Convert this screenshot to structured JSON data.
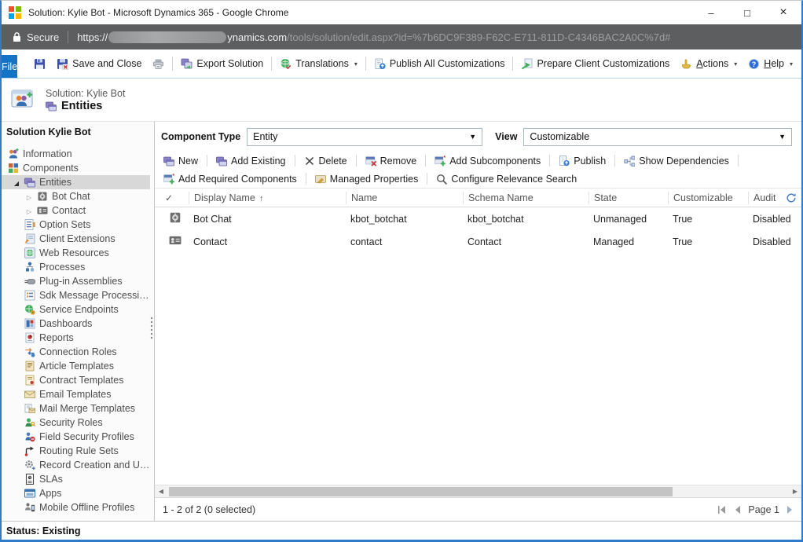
{
  "window": {
    "title": "Solution: Kylie Bot - Microsoft Dynamics 365 - Google Chrome",
    "minimize": "–",
    "maximize": "□",
    "close": "×"
  },
  "address": {
    "secure": "Secure",
    "scheme": "https://",
    "domain": "ynamics.com",
    "path": "/tools/solution/edit.aspx?id=%7b6DC9F389-F62C-E711-811D-C4346BAC2A0C%7d#"
  },
  "ribbon": {
    "file": "File",
    "save_and_close": "Save and Close",
    "export_solution": "Export Solution",
    "translations": "Translations",
    "publish_all": "Publish All Customizations",
    "prepare_client": "Prepare Client Customizations",
    "actions": "Actions",
    "help": "Help"
  },
  "header": {
    "solution": "Solution: Kylie Bot",
    "title": "Entities"
  },
  "sidebar": {
    "title": "Solution Kylie Bot",
    "items": [
      {
        "label": "Information",
        "icon": "information-icon"
      },
      {
        "label": "Components",
        "icon": "components-icon"
      },
      {
        "label": "Entities",
        "icon": "entities-icon",
        "selected": true,
        "expanded": true
      },
      {
        "label": "Bot Chat",
        "icon": "bot-chat-entity-icon",
        "expanded": false
      },
      {
        "label": "Contact",
        "icon": "contact-entity-icon",
        "expanded": false
      },
      {
        "label": "Option Sets",
        "icon": "option-sets-icon"
      },
      {
        "label": "Client Extensions",
        "icon": "client-extensions-icon"
      },
      {
        "label": "Web Resources",
        "icon": "web-resources-icon"
      },
      {
        "label": "Processes",
        "icon": "processes-icon"
      },
      {
        "label": "Plug-in Assemblies",
        "icon": "plugin-assemblies-icon"
      },
      {
        "label": "Sdk Message Processing St...",
        "icon": "sdk-message-steps-icon"
      },
      {
        "label": "Service Endpoints",
        "icon": "service-endpoints-icon"
      },
      {
        "label": "Dashboards",
        "icon": "dashboards-icon"
      },
      {
        "label": "Reports",
        "icon": "reports-icon"
      },
      {
        "label": "Connection Roles",
        "icon": "connection-roles-icon"
      },
      {
        "label": "Article Templates",
        "icon": "article-templates-icon"
      },
      {
        "label": "Contract Templates",
        "icon": "contract-templates-icon"
      },
      {
        "label": "Email Templates",
        "icon": "email-templates-icon"
      },
      {
        "label": "Mail Merge Templates",
        "icon": "mail-merge-templates-icon"
      },
      {
        "label": "Security Roles",
        "icon": "security-roles-icon"
      },
      {
        "label": "Field Security Profiles",
        "icon": "field-security-profiles-icon"
      },
      {
        "label": "Routing Rule Sets",
        "icon": "routing-rule-sets-icon"
      },
      {
        "label": "Record Creation and Upda...",
        "icon": "record-creation-icon"
      },
      {
        "label": "SLAs",
        "icon": "slas-icon"
      },
      {
        "label": "Apps",
        "icon": "apps-icon"
      },
      {
        "label": "Mobile Offline Profiles",
        "icon": "mobile-offline-profiles-icon"
      }
    ]
  },
  "main": {
    "component_type_label": "Component Type",
    "component_type_value": "Entity",
    "view_label": "View",
    "view_value": "Customizable",
    "toolbar": {
      "new": "New",
      "add_existing": "Add Existing",
      "delete": "Delete",
      "remove": "Remove",
      "add_subcomponents": "Add Subcomponents",
      "publish": "Publish",
      "show_dependencies": "Show Dependencies",
      "add_required": "Add Required Components",
      "managed_properties": "Managed Properties",
      "configure_relevance": "Configure Relevance Search"
    },
    "table": {
      "columns": [
        "Display Name",
        "Name",
        "Schema Name",
        "State",
        "Customizable",
        "Audit"
      ],
      "sort": {
        "column": "Display Name",
        "direction": "ascending"
      },
      "rows": [
        {
          "display_name": "Bot Chat",
          "name": "kbot_botchat",
          "schema_name": "kbot_botchat",
          "state": "Unmanaged",
          "customizable": "True",
          "audit": "Disabled",
          "icon": "bot-chat-entity-icon"
        },
        {
          "display_name": "Contact",
          "name": "contact",
          "schema_name": "Contact",
          "state": "Managed",
          "customizable": "True",
          "audit": "Disabled",
          "icon": "contact-entity-icon"
        }
      ]
    },
    "footer": {
      "count": "1 - 2 of 2 (0 selected)",
      "page": "Page 1"
    }
  },
  "status": {
    "text": "Status: Existing"
  }
}
